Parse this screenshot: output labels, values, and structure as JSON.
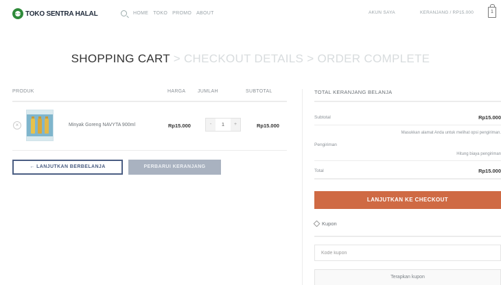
{
  "header": {
    "logo_text": "TOKO SENTRA HALAL",
    "nav": [
      "HOME",
      "TOKO",
      "PROMO",
      "ABOUT"
    ],
    "account_label": "AKUN SAYA",
    "cart_label": "KERANJANG / RP15.000",
    "cart_count": "1"
  },
  "steps": {
    "active": "SHOPPING CART",
    "separator": ">",
    "checkout": "CHECKOUT DETAILS",
    "complete": "ORDER COMPLETE"
  },
  "cart": {
    "columns": [
      "PRODUK",
      "HARGA",
      "JUMLAH",
      "SUBTOTAL"
    ],
    "items": [
      {
        "remove": "×",
        "name": "Minyak Goreng NAVYTA 900ml",
        "price": "Rp15.000",
        "qty_minus": "-",
        "qty": "1",
        "qty_plus": "+",
        "subtotal": "Rp15.000"
      }
    ],
    "continue_label": "← LANJUTKAN BERBELANJA",
    "update_label": "PERBARUI KERANJANG"
  },
  "totals": {
    "title": "TOTAL KERANJANG BELANJA",
    "subtotal_label": "Subtotal",
    "subtotal_value": "Rp15.000",
    "shipping_label": "Pengiriman",
    "shipping_note": "Masukkan alamat Anda untuk melihat opsi pengiriman.",
    "shipping_cost": "Hitung biaya pengiriman",
    "total_label": "Total",
    "total_value": "Rp15.000",
    "checkout_label": "LANJUTKAN KE CHECKOUT",
    "coupon_heading": "Kupon",
    "coupon_placeholder": "Kode kupon",
    "apply_label": "Terapkan kupon"
  },
  "colors": {
    "brand_green": "#2f8a3a",
    "checkout_orange": "#cf6a44",
    "button_blue": "#4a5d82",
    "update_gray": "#a9b2c0"
  }
}
